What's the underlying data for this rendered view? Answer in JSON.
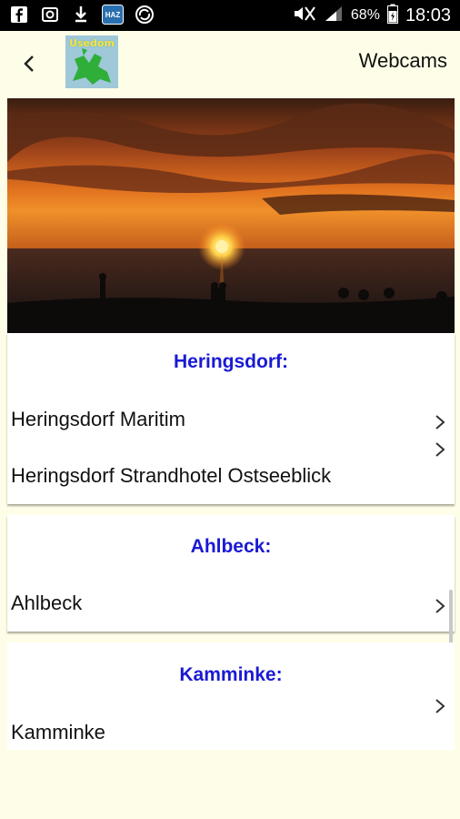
{
  "status_bar": {
    "battery_percent": "68%",
    "time": "18:03",
    "icons": [
      "facebook-icon",
      "photo-icon",
      "download-icon",
      "haz-app-icon",
      "sync-icon",
      "mute-icon",
      "signal-icon",
      "battery-icon"
    ],
    "haz_label": "HAZ"
  },
  "header": {
    "logo_text": "Usedom",
    "title": "Webcams"
  },
  "sections": [
    {
      "title": "Heringsdorf:",
      "items": [
        "Heringsdorf Maritim",
        "Heringsdorf Strandhotel Ostseeblick"
      ]
    },
    {
      "title": "Ahlbeck:",
      "items": [
        "Ahlbeck"
      ]
    },
    {
      "title": "Kamminke:",
      "items": [
        "Kamminke"
      ]
    }
  ],
  "colors": {
    "background": "#fefee8",
    "section_title": "#1a1ad4",
    "status_bar": "#000000"
  }
}
